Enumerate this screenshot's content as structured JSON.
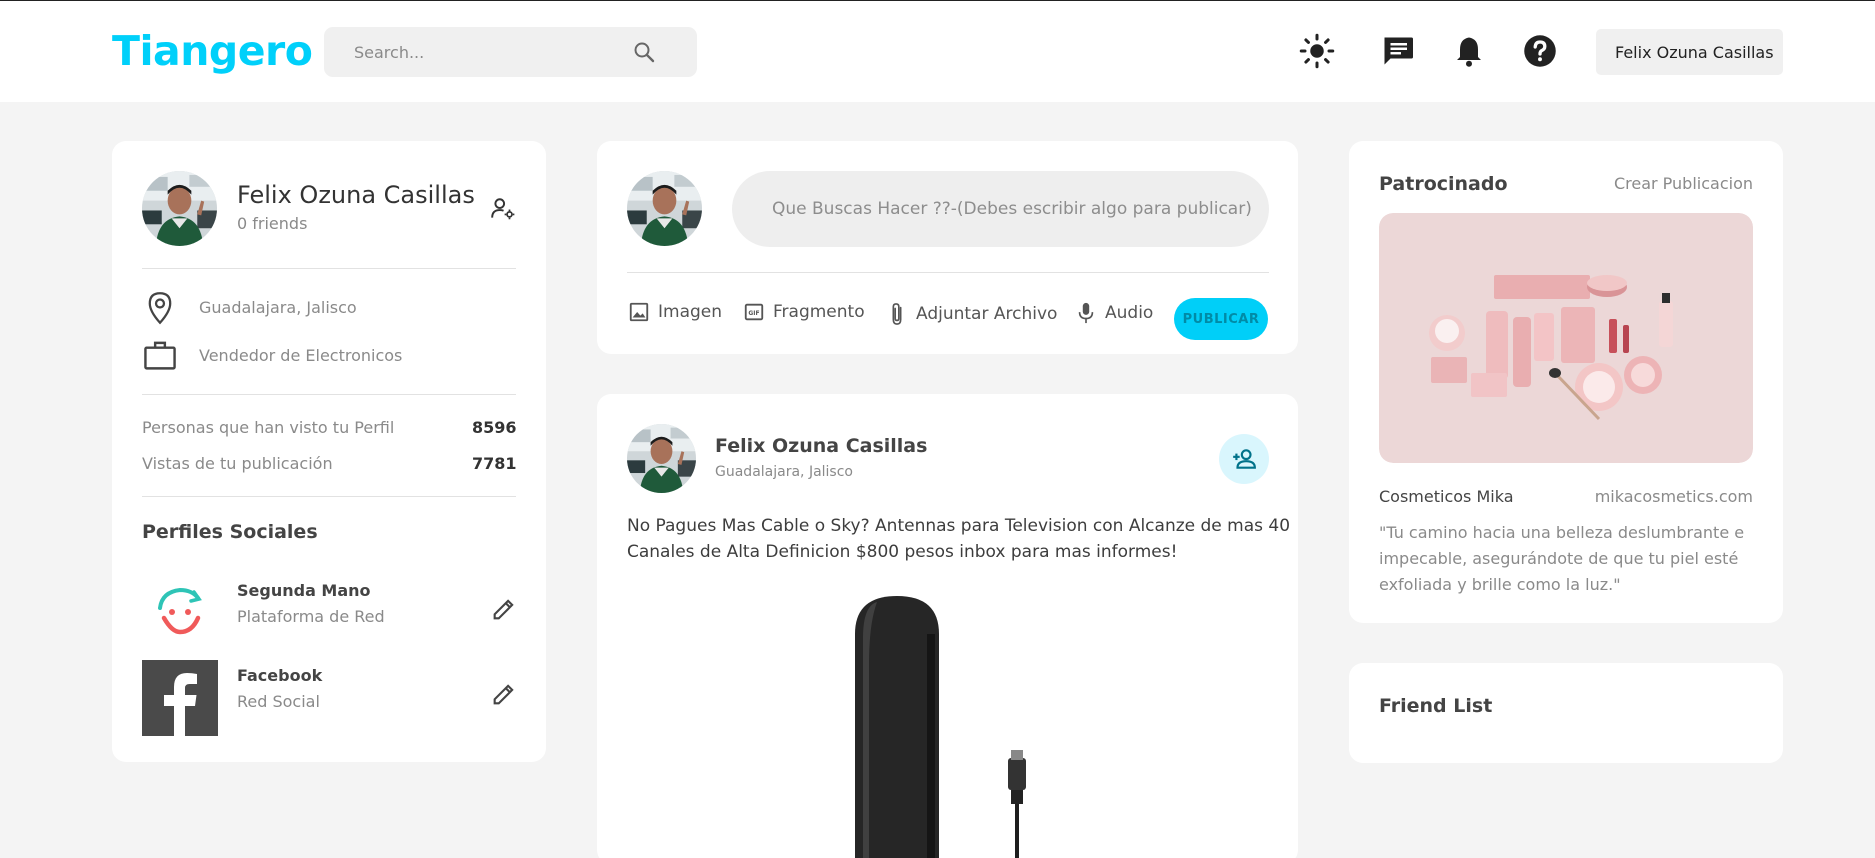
{
  "header": {
    "logo": "Tiangero",
    "search_placeholder": "Search...",
    "icons": [
      "search-icon",
      "sun-icon",
      "message-icon",
      "bell-icon",
      "help-icon"
    ],
    "user_button": "Felix Ozuna Casillas"
  },
  "profile": {
    "name": "Felix Ozuna Casillas",
    "friends": "0 friends",
    "location": "Guadalajara, Jalisco",
    "occupation": "Vendedor de Electronicos",
    "stats": [
      {
        "label": "Personas que han visto tu Perfil",
        "value": "8596"
      },
      {
        "label": "Vistas de tu publicación",
        "value": "7781"
      }
    ],
    "social_title": "Perfiles Sociales",
    "social": [
      {
        "name": "Segunda Mano",
        "type": "Plataforma de Red"
      },
      {
        "name": "Facebook",
        "type": "Red Social"
      }
    ]
  },
  "composer": {
    "placeholder": "Que Buscas Hacer ??-(Debes escribir algo para publicar)",
    "actions": [
      "Imagen",
      "Fragmento",
      "Adjuntar Archivo",
      "Audio"
    ],
    "publish": "PUBLICAR"
  },
  "post": {
    "author": "Felix Ozuna Casillas",
    "location": "Guadalajara, Jalisco",
    "text_line1": "No Pagues Mas Cable o Sky? Antennas para Television con Alcanze de mas 40",
    "text_line2": "Canales de Alta Definicion $800 pesos inbox para mas informes!"
  },
  "sponsored": {
    "title": "Patrocinado",
    "create_link": "Crear Publicacion",
    "brand": "Cosmeticos Mika",
    "url": "mikacosmetics.com",
    "quote_line1": "\"Tu camino hacia una belleza deslumbrante e",
    "quote_line2": "impecable, asegurándote de que tu piel esté",
    "quote_line3": "exfoliada y brille como la luz.\""
  },
  "friend_list": {
    "title": "Friend List"
  },
  "colors": {
    "accent": "#00d0fa",
    "background": "#f4f4f4",
    "card": "#ffffff"
  }
}
